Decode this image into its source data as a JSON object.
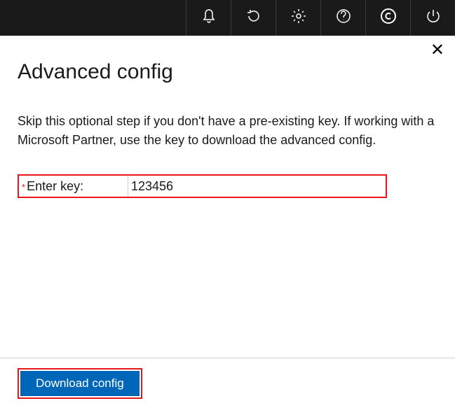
{
  "topbar": {
    "icons": [
      "bell",
      "refresh",
      "settings",
      "help",
      "copyright",
      "power"
    ]
  },
  "dialog": {
    "title": "Advanced config",
    "description": "Skip this optional step if you don't have a pre-existing key. If working with a Microsoft Partner, use the key to download the advanced config.",
    "field_label": "Enter key:",
    "field_value": "123456",
    "required_mark": "*",
    "action_label": "Download config"
  }
}
